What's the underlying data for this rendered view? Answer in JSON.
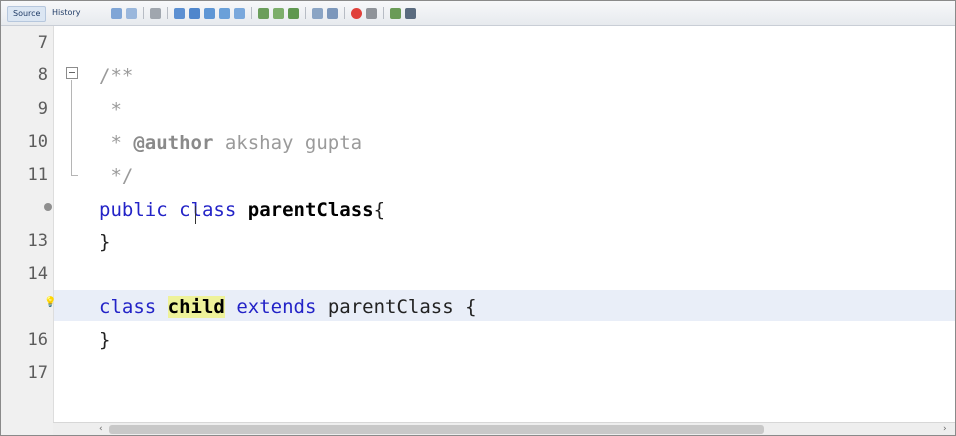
{
  "toolbar": {
    "tabs": [
      {
        "label": "Source",
        "active": true
      },
      {
        "label": "History",
        "active": false
      }
    ],
    "icons": [
      "back-history-icon",
      "last-edit-icon",
      "forward-icon",
      "find-previous-icon",
      "find-next-icon",
      "find-selection-icon",
      "toggle-highlight-icon",
      "toggle-rectangular-icon",
      "shift-left-icon",
      "shift-right-icon",
      "comment-icon",
      "uncomment-icon",
      "record-macro-icon",
      "stop-macro-icon",
      "diff-icon",
      "run-icon"
    ],
    "accent": "#1f3b66"
  },
  "editor": {
    "lines": [
      {
        "number": "7"
      },
      {
        "number": "8"
      },
      {
        "number": "9"
      },
      {
        "number": "10"
      },
      {
        "number": "11"
      },
      {
        "number": ""
      },
      {
        "number": "13"
      },
      {
        "number": "14"
      },
      {
        "number": ""
      },
      {
        "number": "16"
      },
      {
        "number": "17"
      }
    ],
    "code": {
      "l8": "/**",
      "l9": " *",
      "l10_prefix": " * ",
      "l10_tag": "@author",
      "l10_text": " akshay gupta",
      "l11": " */",
      "l12_kw1": "public",
      "l12_kw2": "class",
      "l12_name": "parentClass",
      "l12_brace": "{",
      "l13": "}",
      "l15_kw1": "class",
      "l15_name": "child",
      "l15_kw2": "extends",
      "l15_type": "parentClass",
      "l15_brace": "{",
      "l16": "}"
    },
    "colors": {
      "keyword": "#2323c7",
      "comment": "#9a9a9a",
      "highlight_line": "#e9eef8",
      "mark": "#eef29a"
    }
  },
  "scrollbar": {
    "left_arrow": "‹",
    "right_arrow": "›"
  }
}
